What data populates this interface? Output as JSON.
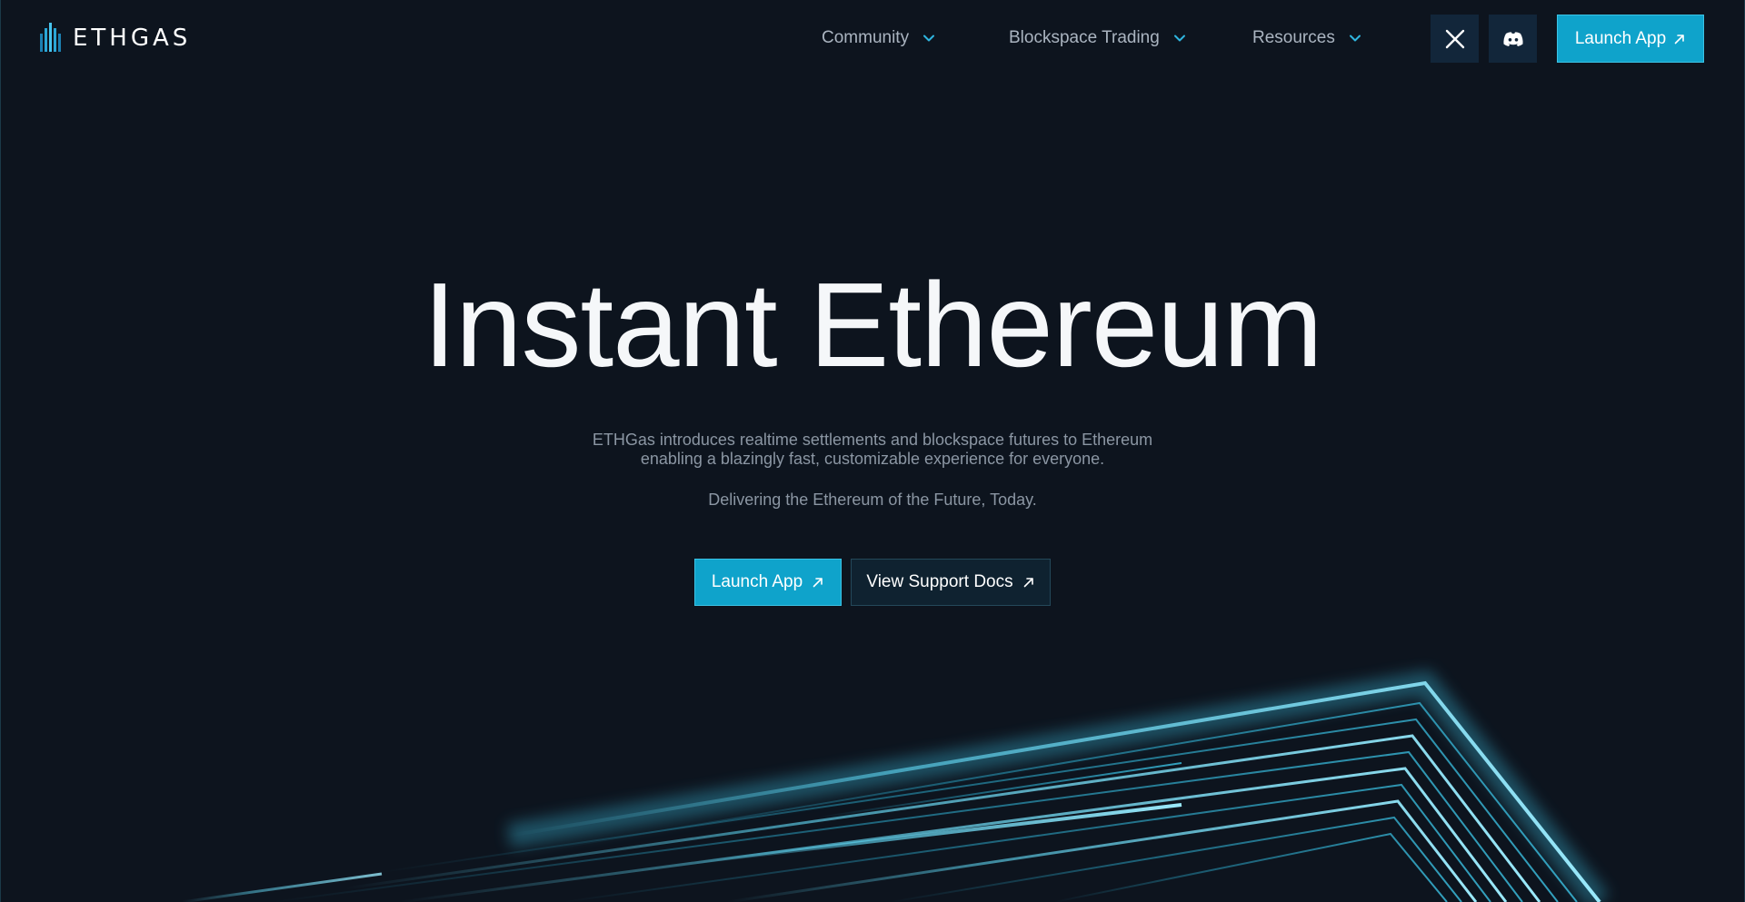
{
  "header": {
    "logo_text": "ETHGAS",
    "nav": [
      {
        "label": "Community",
        "icon": "chevron-down-icon"
      },
      {
        "label": "Blockspace Trading",
        "icon": "chevron-down-icon"
      },
      {
        "label": "Resources",
        "icon": "chevron-down-icon"
      }
    ],
    "social": [
      {
        "name": "x-icon"
      },
      {
        "name": "discord-icon"
      }
    ],
    "launch_label": "Launch App"
  },
  "hero": {
    "title": "Instant Ethereum",
    "subtitle_line1": "ETHGas introduces realtime settlements and blockspace futures to Ethereum",
    "subtitle_line2": "enabling a blazingly fast, customizable experience for everyone.",
    "tagline": "Delivering the Ethereum of the Future, Today.",
    "launch_label": "Launch App",
    "docs_label": "View Support Docs"
  },
  "colors": {
    "background": "#0d141e",
    "accent": "#0fa3cb",
    "glow": "#5fd8f5",
    "social_button": "#12263a"
  }
}
